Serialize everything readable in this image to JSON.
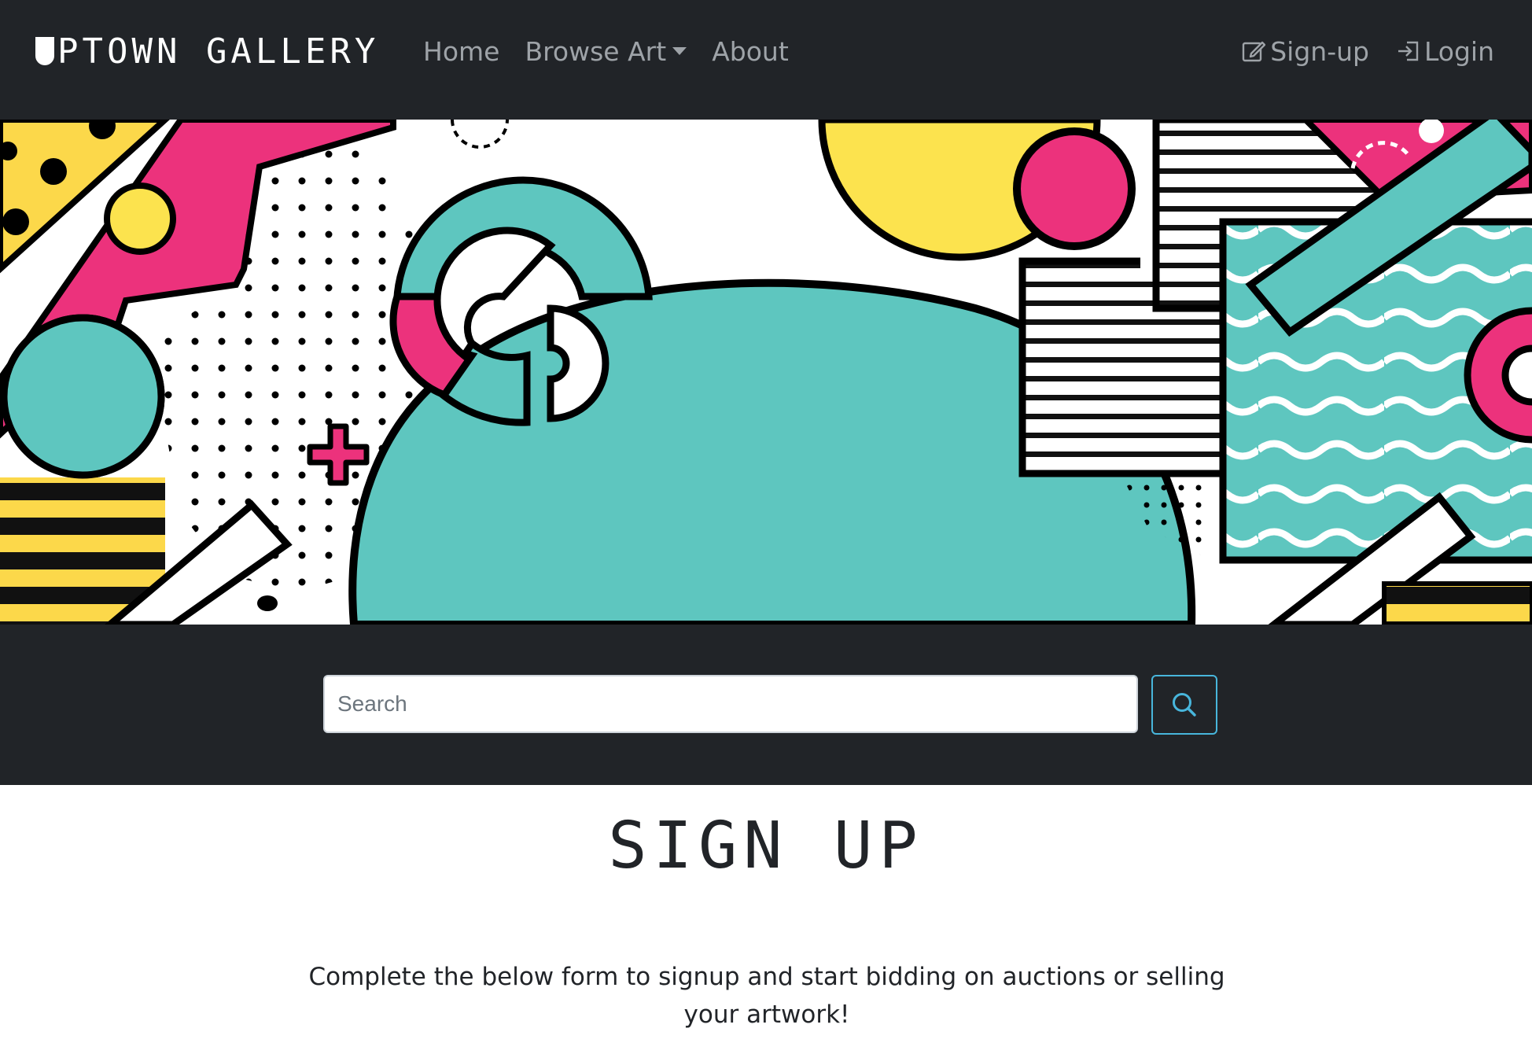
{
  "header": {
    "brand": "UPTOWN GALLERY",
    "brand_rest": "PTOWN GALLERY",
    "nav": {
      "home": "Home",
      "browse_art": "Browse Art",
      "about": "About",
      "signup": "Sign-up",
      "login": "Login"
    }
  },
  "search": {
    "placeholder": "Search"
  },
  "page": {
    "title": "SIGN UP",
    "intro": "Complete the below form to signup and start bidding on auctions or selling your artwork!"
  },
  "colors": {
    "navbar_bg": "#212428",
    "teal": "#5ec6bf",
    "pink": "#ec327c",
    "yellow": "#fce34e",
    "search_button_border": "#48b6dc"
  },
  "icons": {
    "search": "search-icon",
    "signup": "pencil-square-icon",
    "login": "login-arrow-icon",
    "browse_dropdown": "caret-down-icon"
  }
}
